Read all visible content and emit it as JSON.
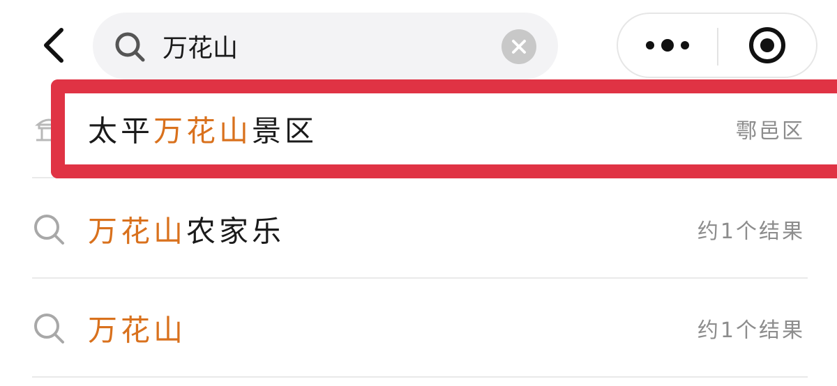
{
  "header": {
    "search": {
      "value": "万花山",
      "placeholder": ""
    }
  },
  "suggestions": [
    {
      "icon": "pavilion-icon",
      "prefix": "太平",
      "highlight": "万花山",
      "suffix": "景区",
      "meta": "鄠邑区"
    },
    {
      "icon": "search-icon",
      "prefix": "",
      "highlight": "万花山",
      "suffix": "农家乐",
      "meta": "约1个结果"
    },
    {
      "icon": "search-icon",
      "prefix": "",
      "highlight": "万花山",
      "suffix": "",
      "meta": "约1个结果"
    }
  ],
  "colors": {
    "highlight_text": "#d9711d",
    "annotation_box": "#e03344",
    "meta_text": "#8c8c8c"
  }
}
